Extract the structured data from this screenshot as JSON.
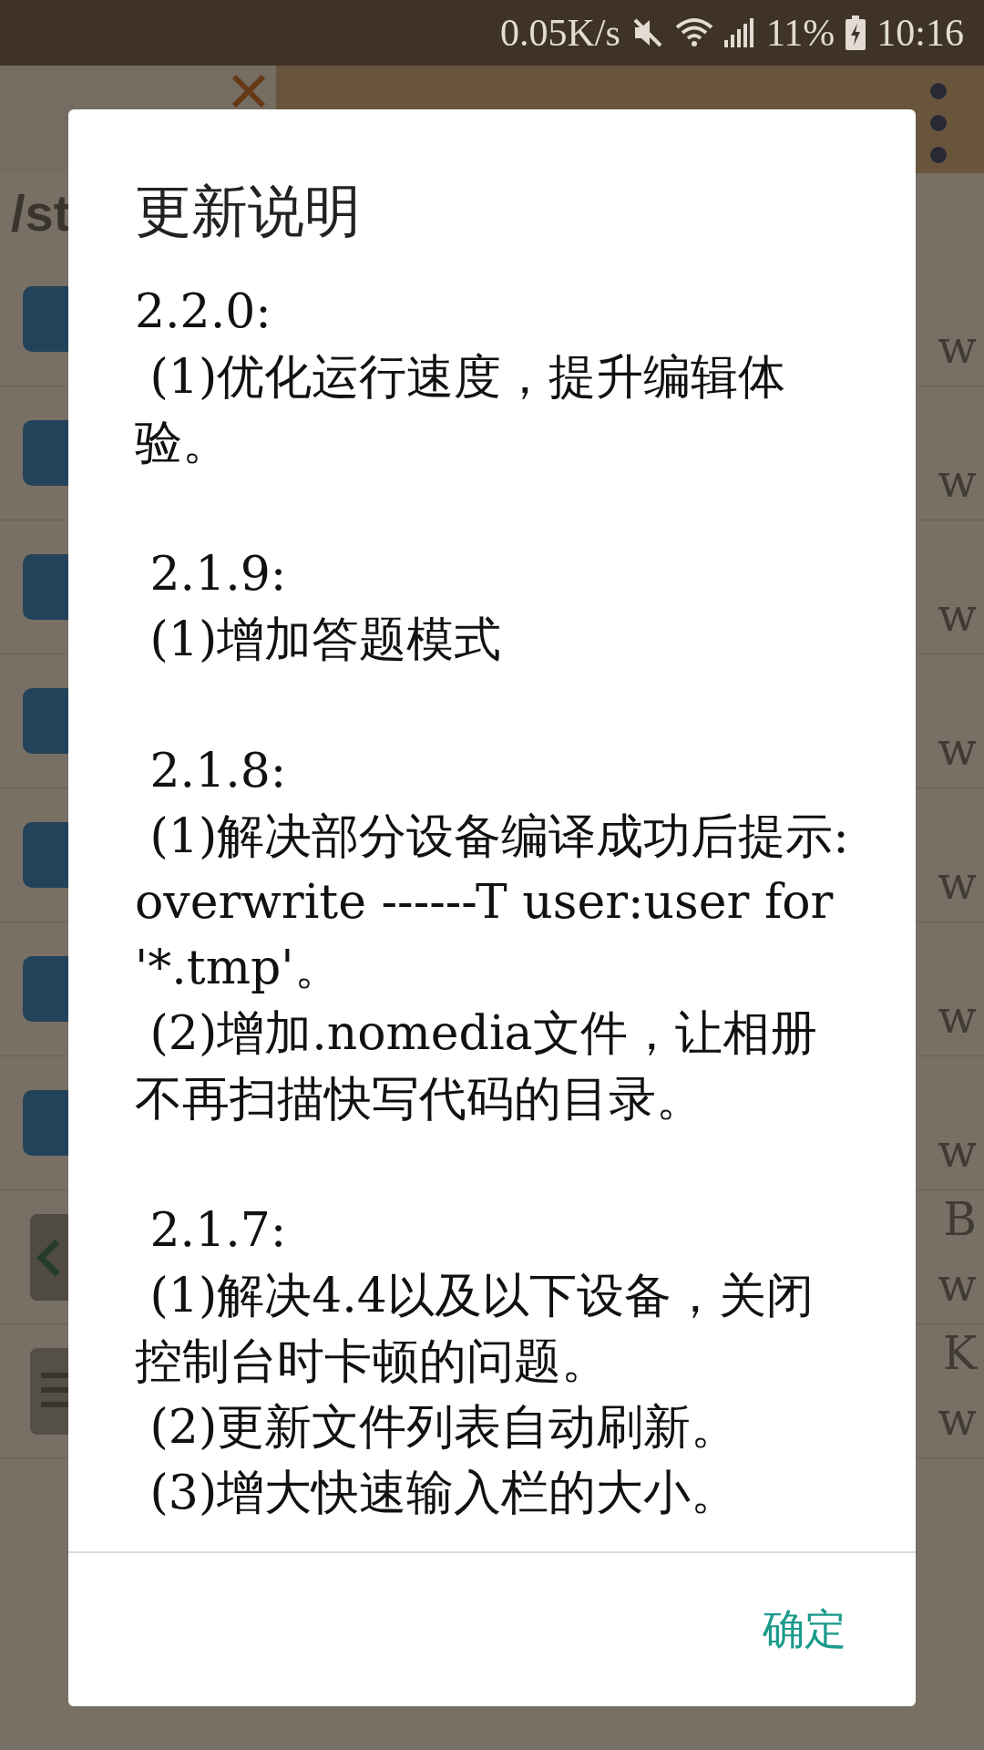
{
  "status_bar": {
    "net_speed": "0.05K/s",
    "battery": "11%",
    "time": "10:16"
  },
  "background": {
    "path": "/st",
    "rows": [
      {
        "kind": "folder",
        "right": [
          "w"
        ]
      },
      {
        "kind": "folder",
        "right": [
          "w"
        ]
      },
      {
        "kind": "folder",
        "right": [
          "w"
        ]
      },
      {
        "kind": "folder",
        "right": [
          "w"
        ]
      },
      {
        "kind": "folder",
        "right": [
          "w"
        ]
      },
      {
        "kind": "folder",
        "right": [
          "w"
        ]
      },
      {
        "kind": "folder",
        "right": [
          "w"
        ]
      },
      {
        "kind": "code",
        "right": [
          "B",
          "w"
        ]
      },
      {
        "kind": "text",
        "right": [
          "K",
          "w"
        ]
      }
    ]
  },
  "dialog": {
    "title": "更新说明",
    "versions": [
      {
        "version": "2.2.0:",
        "notes": [
          " (1)优化运行速度，提升编辑体验。"
        ]
      },
      {
        "version": " 2.1.9:",
        "notes": [
          " (1)增加答题模式"
        ]
      },
      {
        "version": " 2.1.8:",
        "notes": [
          " (1)解决部分设备编译成功后提示:overwrite ------T user:user for '*.tmp'。",
          " (2)增加.nomedia文件，让相册不再扫描快写代码的目录。"
        ]
      },
      {
        "version": " 2.1.7:",
        "notes": [
          " (1)解决4.4以及以下设备，关闭控制台时卡顿的问题。",
          " (2)更新文件列表自动刷新。",
          " (3)增大快速输入栏的大小。"
        ]
      }
    ],
    "button": "确定"
  }
}
